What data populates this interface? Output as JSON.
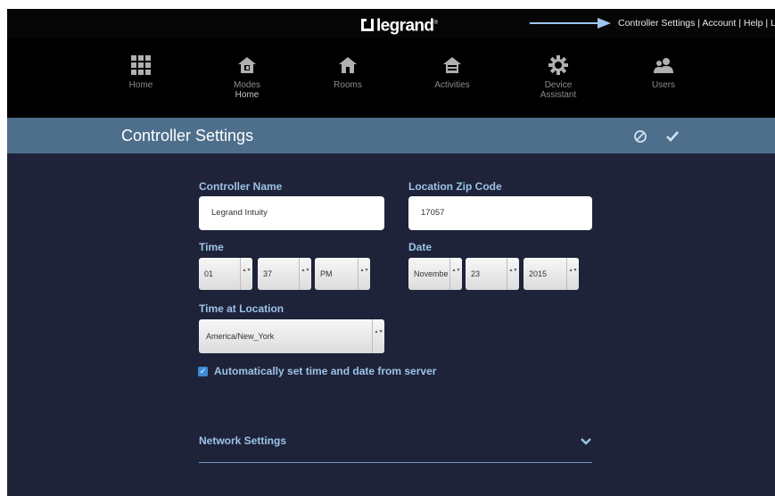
{
  "brand": {
    "logo_text": "legrand",
    "registered": "®"
  },
  "header": {
    "links_text": "Controller Settings | Account | Help | Logout"
  },
  "nav": [
    {
      "label": "Home",
      "sub": "",
      "icon": "grid-icon"
    },
    {
      "label": "Modes",
      "sub": "Home",
      "icon": "modes-house-icon"
    },
    {
      "label": "Rooms",
      "sub": "",
      "icon": "house-icon"
    },
    {
      "label": "Activities",
      "sub": "",
      "icon": "activities-house-icon"
    },
    {
      "label": "Device",
      "sub": "Assistant",
      "icon": "gear-icon"
    },
    {
      "label": "Users",
      "sub": "",
      "icon": "users-icon"
    }
  ],
  "page": {
    "title": "Controller Settings"
  },
  "form": {
    "controller_name_label": "Controller Name",
    "controller_name_value": "Legrand Intuity",
    "zip_label": "Location Zip Code",
    "zip_value": "17057",
    "time_label": "Time",
    "time_hour": "01",
    "time_minute": "37",
    "time_ampm": "PM",
    "date_label": "Date",
    "date_month": "Novembe",
    "date_day": "23",
    "date_year": "2015",
    "timezone_label": "Time at Location",
    "timezone_value": "America/New_York",
    "auto_time_label": "Automatically set time and date from server",
    "auto_time_checked": true
  },
  "network": {
    "label": "Network Settings"
  },
  "colors": {
    "topbar": "#060606",
    "titlebar": "#4e6f8c",
    "main_bg": "#1e2339",
    "label": "#9cc3e6",
    "accent": "#3d8bd9"
  }
}
